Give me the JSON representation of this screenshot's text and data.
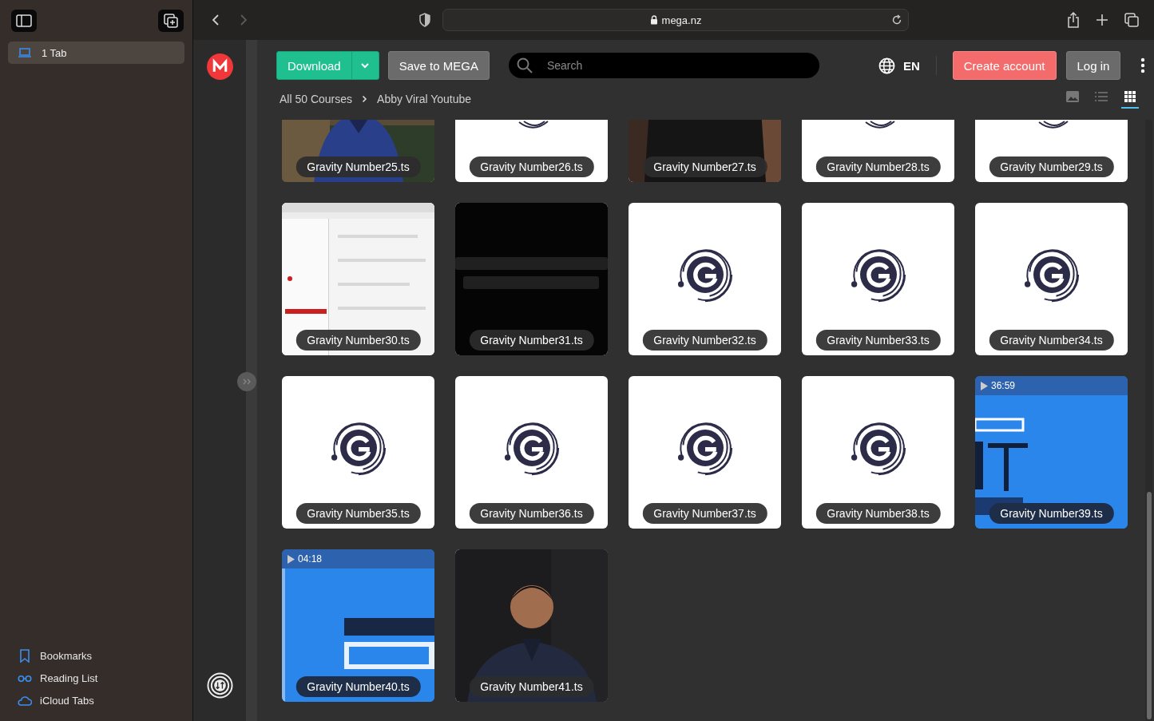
{
  "sidebar": {
    "tab_group": {
      "label": "1 Tab",
      "selected": true
    },
    "items": [
      {
        "label": "Bookmarks"
      },
      {
        "label": "Reading List"
      },
      {
        "label": "iCloud Tabs"
      }
    ]
  },
  "browser": {
    "url": "mega.nz"
  },
  "header": {
    "download": "Download",
    "save": "Save to MEGA",
    "search": {
      "placeholder": "Search"
    },
    "language": "EN",
    "create_account": "Create account",
    "login": "Log in"
  },
  "breadcrumb": [
    "All 50 Courses",
    "Abby Viral Youtube"
  ],
  "views": [
    {
      "selected": false
    },
    {
      "selected": false
    },
    {
      "selected": true
    }
  ],
  "files": [
    {
      "name": "Gravity Number25.ts",
      "kind": "picture"
    },
    {
      "name": "Gravity Number26.ts",
      "kind": "logo"
    },
    {
      "name": "Gravity Number27.ts",
      "kind": "picture"
    },
    {
      "name": "Gravity Number28.ts",
      "kind": "logo"
    },
    {
      "name": "Gravity Number29.ts",
      "kind": "logo"
    },
    {
      "name": "Gravity Number30.ts",
      "kind": "picture"
    },
    {
      "name": "Gravity Number31.ts",
      "kind": "picture"
    },
    {
      "name": "Gravity Number32.ts",
      "kind": "logo"
    },
    {
      "name": "Gravity Number33.ts",
      "kind": "logo"
    },
    {
      "name": "Gravity Number34.ts",
      "kind": "logo"
    },
    {
      "name": "Gravity Number35.ts",
      "kind": "logo"
    },
    {
      "name": "Gravity Number36.ts",
      "kind": "logo"
    },
    {
      "name": "Gravity Number37.ts",
      "kind": "logo"
    },
    {
      "name": "Gravity Number38.ts",
      "kind": "logo"
    },
    {
      "name": "Gravity Number39.ts",
      "kind": "video",
      "duration": "36:59"
    },
    {
      "name": "Gravity Number40.ts",
      "kind": "video",
      "duration": "04:18"
    },
    {
      "name": "Gravity Number41.ts",
      "kind": "picture"
    }
  ]
}
